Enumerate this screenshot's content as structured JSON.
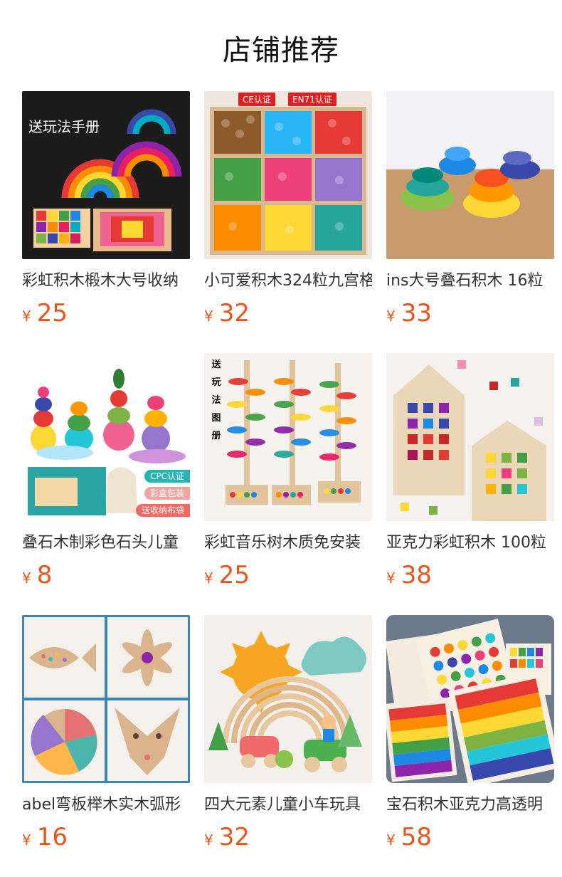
{
  "header": {
    "title": "店铺推荐"
  },
  "currency_symbol": "¥",
  "products": [
    {
      "title": "彩虹积木椴木大号收纳",
      "price": "25",
      "overlay": "送玩法手册"
    },
    {
      "title": "小可爱积木324粒九宫格",
      "price": "32",
      "badges": [
        "CE认证",
        "EN71认证"
      ]
    },
    {
      "title": "ins大号叠石积木 16粒",
      "price": "33"
    },
    {
      "title": "叠石木制彩色石头儿童",
      "price": "8",
      "pills": [
        "CPC认证",
        "彩盒包装",
        "送收纳布袋"
      ]
    },
    {
      "title": "彩虹音乐树木质免安装",
      "price": "25",
      "vertical_text": "送玩法图册"
    },
    {
      "title": "亚克力彩虹积木 100粒",
      "price": "38"
    },
    {
      "title": "abel弯板榉木实木弧形",
      "price": "16"
    },
    {
      "title": "四大元素儿童小车玩具",
      "price": "32"
    },
    {
      "title": "宝石积木亚克力高透明",
      "price": "58"
    }
  ],
  "colors": {
    "price": "#e8541c",
    "title": "#333333",
    "accent_red": "#e02020"
  }
}
